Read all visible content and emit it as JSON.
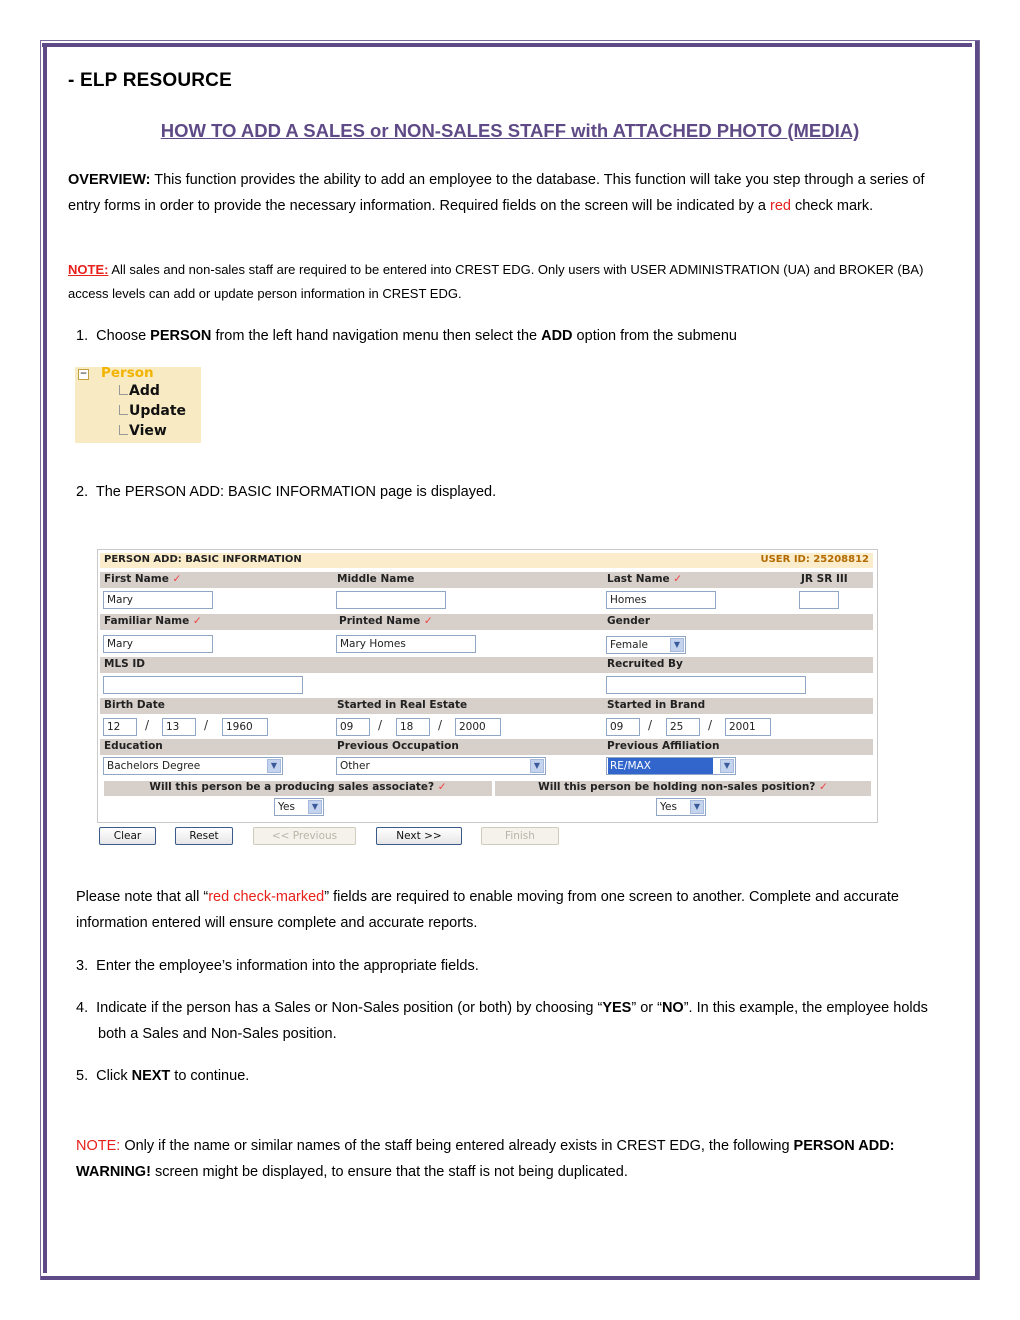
{
  "document": {
    "resource_heading": "-  ELP RESOURCE",
    "title": "HOW TO ADD A SALES or NON-SALES STAFF with ATTACHED PHOTO (MEDIA)",
    "overview": {
      "label": "OVERVIEW:",
      "text_1": " This function provides the ability to add an employee to the database. This function will take you step through a series of entry forms in order to provide the necessary information.  Required fields on the screen will be indicated by a ",
      "red_word": "red",
      "text_2": " check mark."
    },
    "note_1": {
      "label": "NOTE:",
      "text": " All sales and non-sales staff are required to be entered into CREST EDG.  Only users with USER ADMINISTRATION (UA) and BROKER (BA) access levels can add or update person information in CREST EDG."
    },
    "step_1": {
      "num": "1.",
      "pre": "Choose ",
      "bold_1": "PERSON",
      "mid": " from the left hand navigation menu then select the ",
      "bold_2": "ADD",
      "post": " option from the submenu"
    },
    "step_2": {
      "num": "2.",
      "text": "The PERSON ADD: BASIC INFORMATION page is displayed."
    },
    "required_note": {
      "pre": "Please note that all “",
      "red": "red check-marked",
      "post": "” fields are required to enable moving from one screen to another.  Complete and accurate information entered will ensure complete and accurate reports."
    },
    "step_3": {
      "num": "3.",
      "text": "Enter the employee’s information into the appropriate fields."
    },
    "step_4": {
      "num": "4.",
      "pre": "Indicate if the person has a Sales or Non-Sales position (or both) by choosing “",
      "bold_1": "YES",
      "mid": "” or “",
      "bold_2": "NO",
      "post": "”.  In this example, the employee holds both a Sales and Non-Sales position."
    },
    "step_5": {
      "num": "5.",
      "pre": "Click ",
      "bold": "NEXT",
      "post": " to continue."
    },
    "note_2": {
      "label": "NOTE:",
      "text_1": " Only if the name or similar names of the staff being entered already exists in CREST EDG, the following ",
      "bold": "PERSON ADD: WARNING!",
      "text_2": " screen might be displayed, to ensure that the staff is not being duplicated."
    }
  },
  "nav_menu": {
    "toggle_icon": "minus-box-icon",
    "parent": "Person",
    "children": [
      "Add",
      "Update",
      "View"
    ]
  },
  "form": {
    "header_title": "PERSON ADD: BASIC INFORMATION",
    "user_id": "USER ID: 25208812",
    "required_mark": "✓",
    "labels": {
      "first_name": "First Name",
      "middle_name": "Middle Name",
      "last_name": "Last Name",
      "suffix": "JR SR III",
      "familiar_name": "Familiar Name",
      "printed_name": "Printed Name",
      "gender": "Gender",
      "mls_id": "MLS ID",
      "recruited_by": "Recruited By",
      "birth_date": "Birth Date",
      "started_real_estate": "Started in Real Estate",
      "started_brand": "Started in Brand",
      "education": "Education",
      "previous_occupation": "Previous Occupation",
      "previous_affiliation": "Previous Affiliation",
      "q_sales": "Will this person be a producing sales associate?",
      "q_nonsales": "Will this person be holding non-sales position?"
    },
    "values": {
      "first_name": "Mary",
      "middle_name": "",
      "last_name": "Homes",
      "suffix": "",
      "familiar_name": "Mary",
      "printed_name": "Mary  Homes",
      "gender": "Female",
      "mls_id": "",
      "recruited_by": "",
      "birth_date": {
        "mm": "12",
        "dd": "13",
        "yyyy": "1960"
      },
      "started_real_estate": {
        "mm": "09",
        "dd": "18",
        "yyyy": "2000"
      },
      "started_brand": {
        "mm": "09",
        "dd": "25",
        "yyyy": "2001"
      },
      "education": "Bachelors Degree",
      "previous_occupation": "Other",
      "previous_affiliation": "RE/MAX",
      "q_sales": "Yes",
      "q_nonsales": "Yes"
    },
    "date_separator": "/",
    "dropdown_arrow": "▼",
    "buttons": {
      "clear": "Clear",
      "reset": "Reset",
      "previous": "<< Previous",
      "next": "Next >>",
      "finish": "Finish"
    }
  },
  "colors": {
    "frame": "#5e4a86",
    "title": "#5e4a86",
    "required_red": "#e8201c",
    "menu_parent": "#f2b400",
    "user_id": "#b36a00"
  }
}
